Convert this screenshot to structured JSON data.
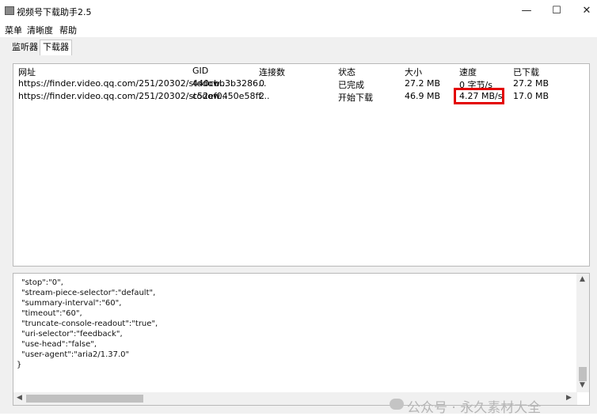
{
  "window": {
    "title": "视频号下载助手2.5",
    "controls": {
      "minimize": "—",
      "maximize": "☐",
      "close": "✕"
    }
  },
  "menu": [
    "菜单",
    "清晰度",
    "帮助"
  ],
  "tabs": [
    {
      "label": "监听器",
      "active": false
    },
    {
      "label": "下载器",
      "active": true
    }
  ],
  "table": {
    "headers": [
      "网址",
      "GID",
      "连接数",
      "状态",
      "大小",
      "速度",
      "已下载"
    ],
    "rows": [
      [
        "https://finder.video.qq.com/251/20302/stodow...",
        "440cbb3b3286...",
        "0",
        "已完成",
        "27.2 MB",
        "0 字节/s",
        "27.2 MB"
      ],
      [
        "https://finder.video.qq.com/251/20302/stodow...",
        "c52ef0450e58ff...",
        "2",
        "开始下载",
        "46.9 MB",
        "4.27 MB/s",
        "17.0 MB"
      ]
    ]
  },
  "log_lines": [
    "\"stop\":\"0\",",
    "\"stream-piece-selector\":\"default\",",
    "\"summary-interval\":\"60\",",
    "\"timeout\":\"60\",",
    "\"truncate-console-readout\":\"true\",",
    "\"uri-selector\":\"feedback\",",
    "\"use-head\":\"false\",",
    "\"user-agent\":\"aria2/1.37.0\"",
    "}"
  ],
  "watermark": "公众号 · 永久素材大全",
  "colors": {
    "highlight": "#e30000",
    "chrome": "#f0f0f0"
  }
}
